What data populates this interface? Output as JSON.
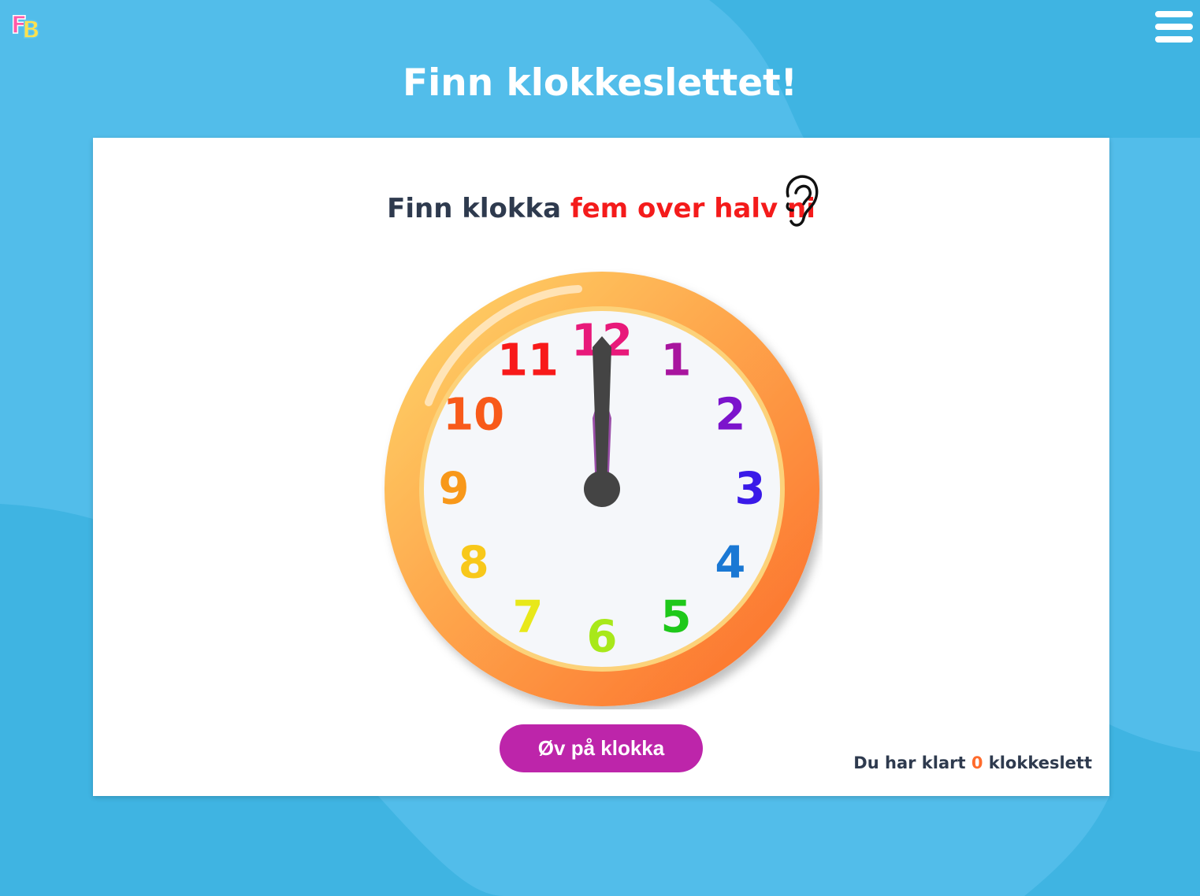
{
  "header": {
    "logo_text": "FB",
    "menu_icon": "hamburger-menu-icon",
    "title": "Finn klokkeslettet!"
  },
  "task": {
    "prefix": "Finn klokka",
    "target_time": "fem over halv ni",
    "listen_icon": "ear-icon"
  },
  "clock": {
    "numbers": [
      "12",
      "1",
      "2",
      "3",
      "4",
      "5",
      "6",
      "7",
      "8",
      "9",
      "10",
      "11"
    ],
    "number_colors": [
      "#e8197a",
      "#a8159e",
      "#7c14cc",
      "#3a1ae8",
      "#1a78d4",
      "#1ec81a",
      "#a8e81a",
      "#e8e81a",
      "#f8c81a",
      "#f8981a",
      "#f85a1a",
      "#f81a1a"
    ],
    "hour_hand_time": "12:00",
    "minute_hand_time": ":00",
    "rim_colors": [
      "#ffd86a",
      "#fc6a28"
    ],
    "hand_color": "#444444",
    "hand_accent_color": "#9a4ea8"
  },
  "actions": {
    "practice_label": "Øv på klokka"
  },
  "score": {
    "prefix": "Du har klart",
    "count": "0",
    "suffix": "klokkeslett"
  },
  "colors": {
    "background": "#52bdea",
    "background_wave": "#3fb4e2",
    "title_red": "#f41b1b",
    "button": "#bd25aa",
    "score_count": "#ff6b2c"
  }
}
